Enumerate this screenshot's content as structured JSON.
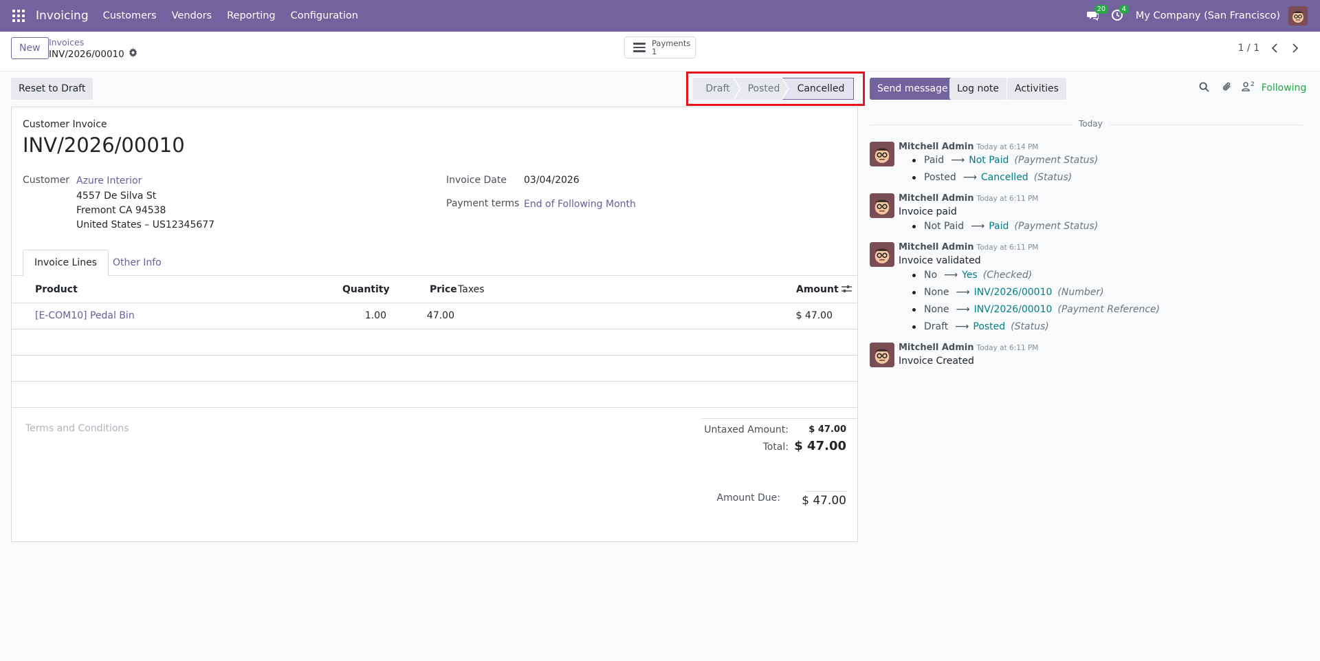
{
  "navbar": {
    "app_name": "Invoicing",
    "menu": [
      "Customers",
      "Vendors",
      "Reporting",
      "Configuration"
    ],
    "messages_count": "20",
    "activities_count": "4",
    "company": "My Company (San Francisco)"
  },
  "control_panel": {
    "new_label": "New",
    "breadcrumb": "Invoices",
    "record_name": "INV/2026/00010",
    "smart_button": {
      "label": "Payments",
      "count": "1"
    },
    "pager": "1 / 1"
  },
  "actions": {
    "reset_label": "Reset to Draft",
    "stages": [
      "Draft",
      "Posted",
      "Cancelled"
    ],
    "active_stage": "Cancelled"
  },
  "chatter_buttons": {
    "send_message": "Send message",
    "log_note": "Log note",
    "activities": "Activities",
    "followers_count": "2",
    "following": "Following"
  },
  "form": {
    "doc_type": "Customer Invoice",
    "title": "INV/2026/00010",
    "customer_label": "Customer",
    "customer_name": "Azure Interior",
    "address": [
      "4557 De Silva St",
      "Fremont CA 94538",
      "United States – US12345677"
    ],
    "invoice_date_label": "Invoice Date",
    "invoice_date": "03/04/2026",
    "payment_terms_label": "Payment terms",
    "payment_terms": "End of Following Month",
    "tabs": [
      "Invoice Lines",
      "Other Info"
    ],
    "columns": {
      "product": "Product",
      "quantity": "Quantity",
      "price": "Price",
      "taxes": "Taxes",
      "amount": "Amount"
    },
    "lines": [
      {
        "product": "[E-COM10] Pedal Bin",
        "quantity": "1.00",
        "price": "47.00",
        "taxes": "",
        "amount": "$ 47.00"
      }
    ],
    "terms_placeholder": "Terms and Conditions",
    "totals": {
      "untaxed_label": "Untaxed Amount:",
      "untaxed": "$ 47.00",
      "total_label": "Total:",
      "total": "$ 47.00",
      "due_label": "Amount Due:",
      "due": "$ 47.00"
    }
  },
  "chatter": {
    "date_separator": "Today",
    "messages": [
      {
        "author": "Mitchell Admin",
        "date": "Today at 6:14 PM",
        "body": "",
        "tracking": [
          {
            "old": "Paid",
            "new": "Not Paid",
            "field": "(Payment Status)"
          },
          {
            "old": "Posted",
            "new": "Cancelled",
            "field": "(Status)"
          }
        ]
      },
      {
        "author": "Mitchell Admin",
        "date": "Today at 6:11 PM",
        "body": "Invoice paid",
        "tracking": [
          {
            "old": "Not Paid",
            "new": "Paid",
            "field": "(Payment Status)"
          }
        ]
      },
      {
        "author": "Mitchell Admin",
        "date": "Today at 6:11 PM",
        "body": "Invoice validated",
        "tracking": [
          {
            "old": "No",
            "new": "Yes",
            "field": "(Checked)"
          },
          {
            "old": "None",
            "new": "INV/2026/00010",
            "field": "(Number)"
          },
          {
            "old": "None",
            "new": "INV/2026/00010",
            "field": "(Payment Reference)"
          },
          {
            "old": "Draft",
            "new": "Posted",
            "field": "(Status)"
          }
        ]
      },
      {
        "author": "Mitchell Admin",
        "date": "Today at 6:11 PM",
        "body": "Invoice Created",
        "tracking": []
      }
    ]
  }
}
